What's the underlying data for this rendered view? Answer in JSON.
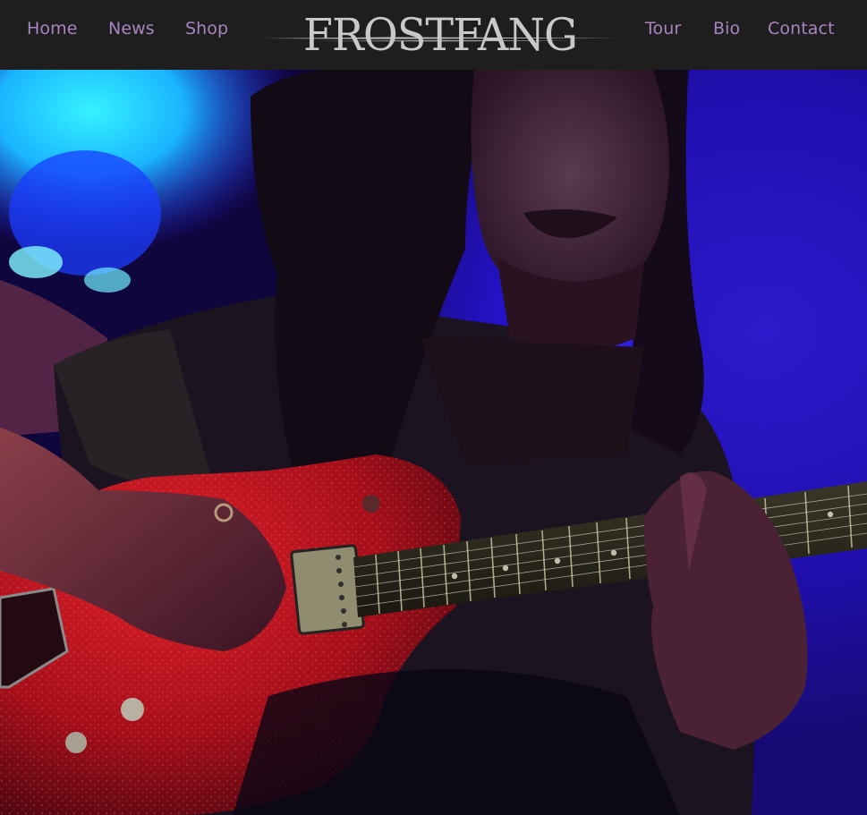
{
  "nav": {
    "left_items": [
      {
        "label": "Home"
      },
      {
        "label": "News"
      },
      {
        "label": "Shop"
      }
    ],
    "right_items": [
      {
        "label": "Tour"
      },
      {
        "label": "Bio"
      },
      {
        "label": "Contact"
      }
    ],
    "logo_text": "FROSTFANG"
  },
  "colors": {
    "navbar_bg": "#1e1e1f",
    "nav_link": "#a985c0",
    "logo": "#c9c9c9",
    "guitar_red": "#c0141e",
    "stage_blue": "#2d1bff",
    "stage_cyan": "#22e6ff"
  }
}
